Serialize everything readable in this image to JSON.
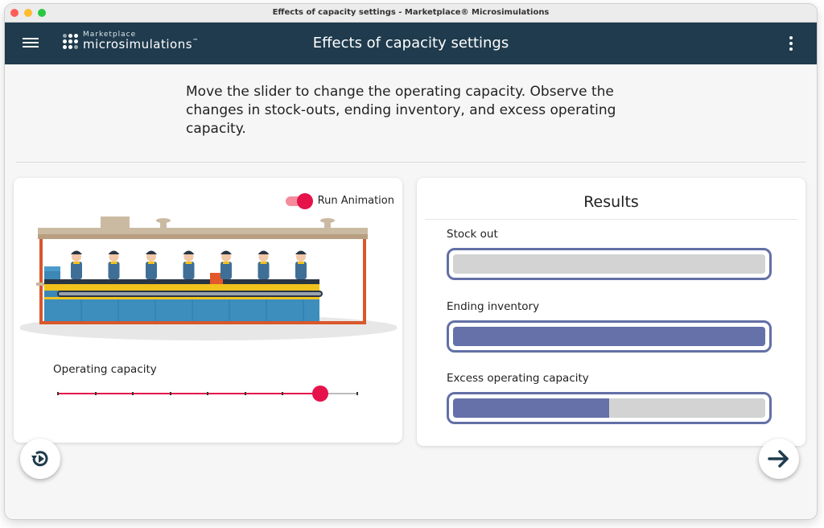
{
  "window": {
    "title": "Effects of capacity settings - Marketplace® Microsimulations"
  },
  "appbar": {
    "logo_small": "Marketplace",
    "logo_big": "microsimulations",
    "logo_mark": "™",
    "title": "Effects of capacity settings"
  },
  "instructions": "Move the slider to change the operating capacity. Observe the changes in stock-outs, ending inventory, and excess operating capacity.",
  "animation": {
    "toggle_label": "Run Animation",
    "enabled": true,
    "worker_count": 7
  },
  "slider": {
    "label": "Operating capacity",
    "min": 0,
    "max": 8,
    "value": 7,
    "accent": "#e5134a"
  },
  "results": {
    "title": "Results",
    "metrics": [
      {
        "label": "Stock out",
        "fraction": 0.0
      },
      {
        "label": "Ending inventory",
        "fraction": 1.0
      },
      {
        "label": "Excess operating capacity",
        "fraction": 0.5
      }
    ],
    "bar_color": "#6571a8",
    "frame_color": "#6370a6"
  },
  "nav": {
    "restart_icon": "restart-icon",
    "next_icon": "arrow-right-icon"
  },
  "colors": {
    "appbar": "#1f3b4d",
    "accent": "#e5134a"
  }
}
